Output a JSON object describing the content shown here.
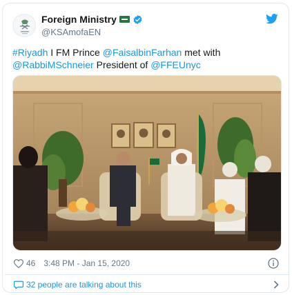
{
  "account": {
    "display_name": "Foreign Ministry",
    "handle": "@KSAmofaEN",
    "flag_icon": "saudi-flag-icon",
    "verified_icon": "verified-badge-icon",
    "platform_icon": "twitter-bird-icon"
  },
  "tweet": {
    "segments": [
      {
        "text": "#Riyadh",
        "type": "link"
      },
      {
        "text": " I FM Prince ",
        "type": "text"
      },
      {
        "text": "@FaisalbinFarhan",
        "type": "link"
      },
      {
        "text": " met with ",
        "type": "text"
      },
      {
        "text": "@RabbiMSchneier",
        "type": "link"
      },
      {
        "text": " President of ",
        "type": "text"
      },
      {
        "text": "@FFEUnyc",
        "type": "link"
      }
    ]
  },
  "meta": {
    "likes": "46",
    "timestamp": "3:48 PM - Jan 15, 2020"
  },
  "conversation": {
    "label": "32 people are talking about this"
  },
  "colors": {
    "link": "#1b95e0",
    "text": "#14171a",
    "muted": "#657786",
    "border": "#e1e8ed"
  }
}
